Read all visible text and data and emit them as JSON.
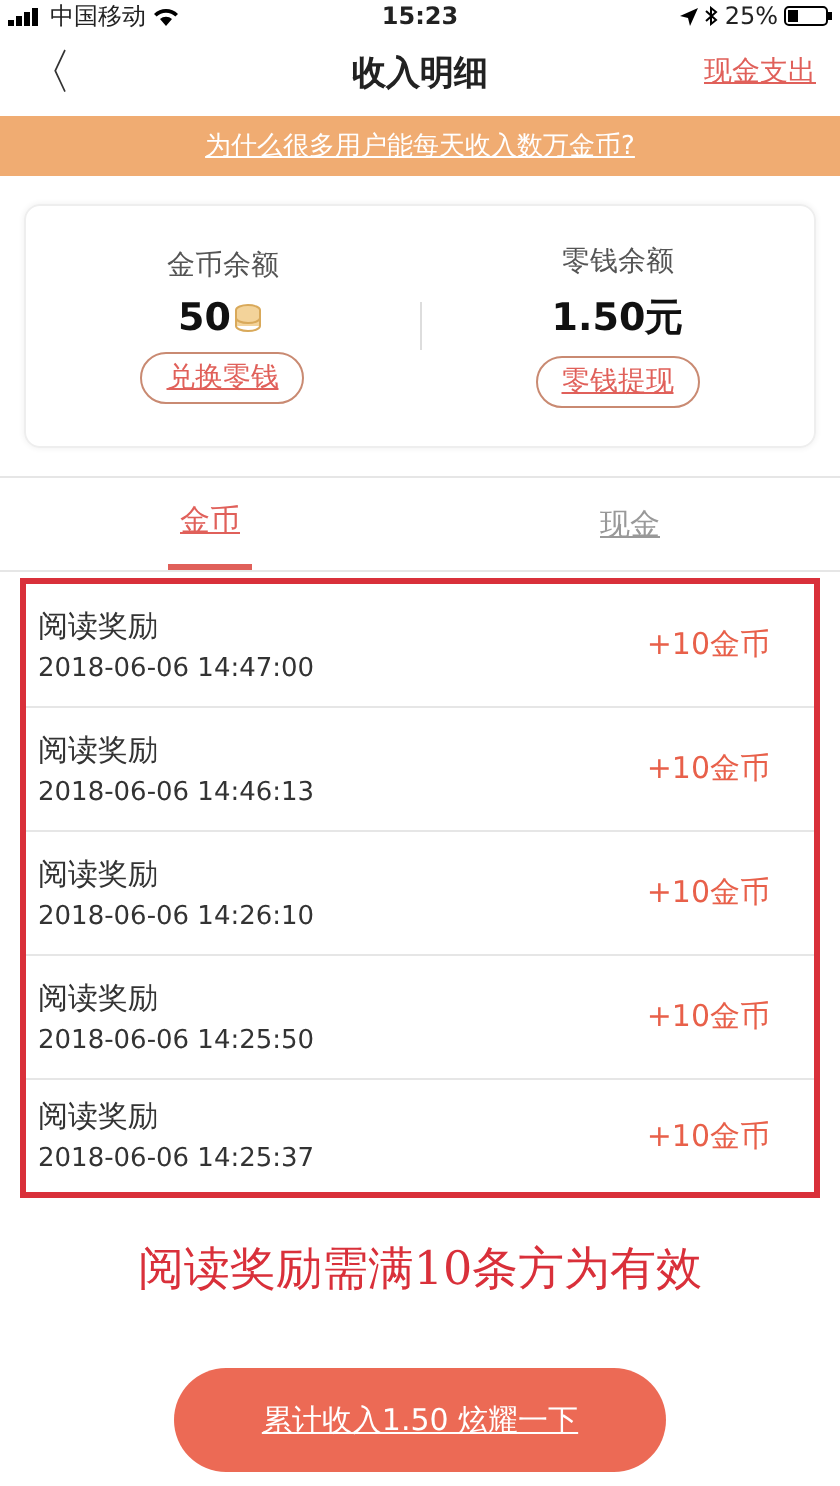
{
  "status_bar": {
    "carrier": "中国移动",
    "time": "15:23",
    "battery": "25%"
  },
  "nav": {
    "back": "〈",
    "title": "收入明细",
    "action": "现金支出"
  },
  "banner": "为什么很多用户能每天收入数万金币?",
  "balances": [
    {
      "label": "金币余额",
      "value": "50",
      "kind": "coins",
      "button": "兑换零钱"
    },
    {
      "label": "零钱余额",
      "value": "1.50元",
      "kind": "cash",
      "button": "零钱提现"
    }
  ],
  "tabs": [
    {
      "label": "金币",
      "selected": true
    },
    {
      "label": "现金",
      "selected": false
    }
  ],
  "records": [
    {
      "title": "阅读奖励",
      "time": "2018-06-06 14:47:00",
      "amount": "+10金币"
    },
    {
      "title": "阅读奖励",
      "time": "2018-06-06 14:46:13",
      "amount": "+10金币"
    },
    {
      "title": "阅读奖励",
      "time": "2018-06-06 14:26:10",
      "amount": "+10金币"
    },
    {
      "title": "阅读奖励",
      "time": "2018-06-06 14:25:50",
      "amount": "+10金币"
    },
    {
      "title": "阅读奖励",
      "time": "2018-06-06 14:25:37",
      "amount": "+10金币"
    }
  ],
  "note": "阅读奖励需满10条方为有效",
  "share_button": "累计收入1.50 炫耀一下"
}
